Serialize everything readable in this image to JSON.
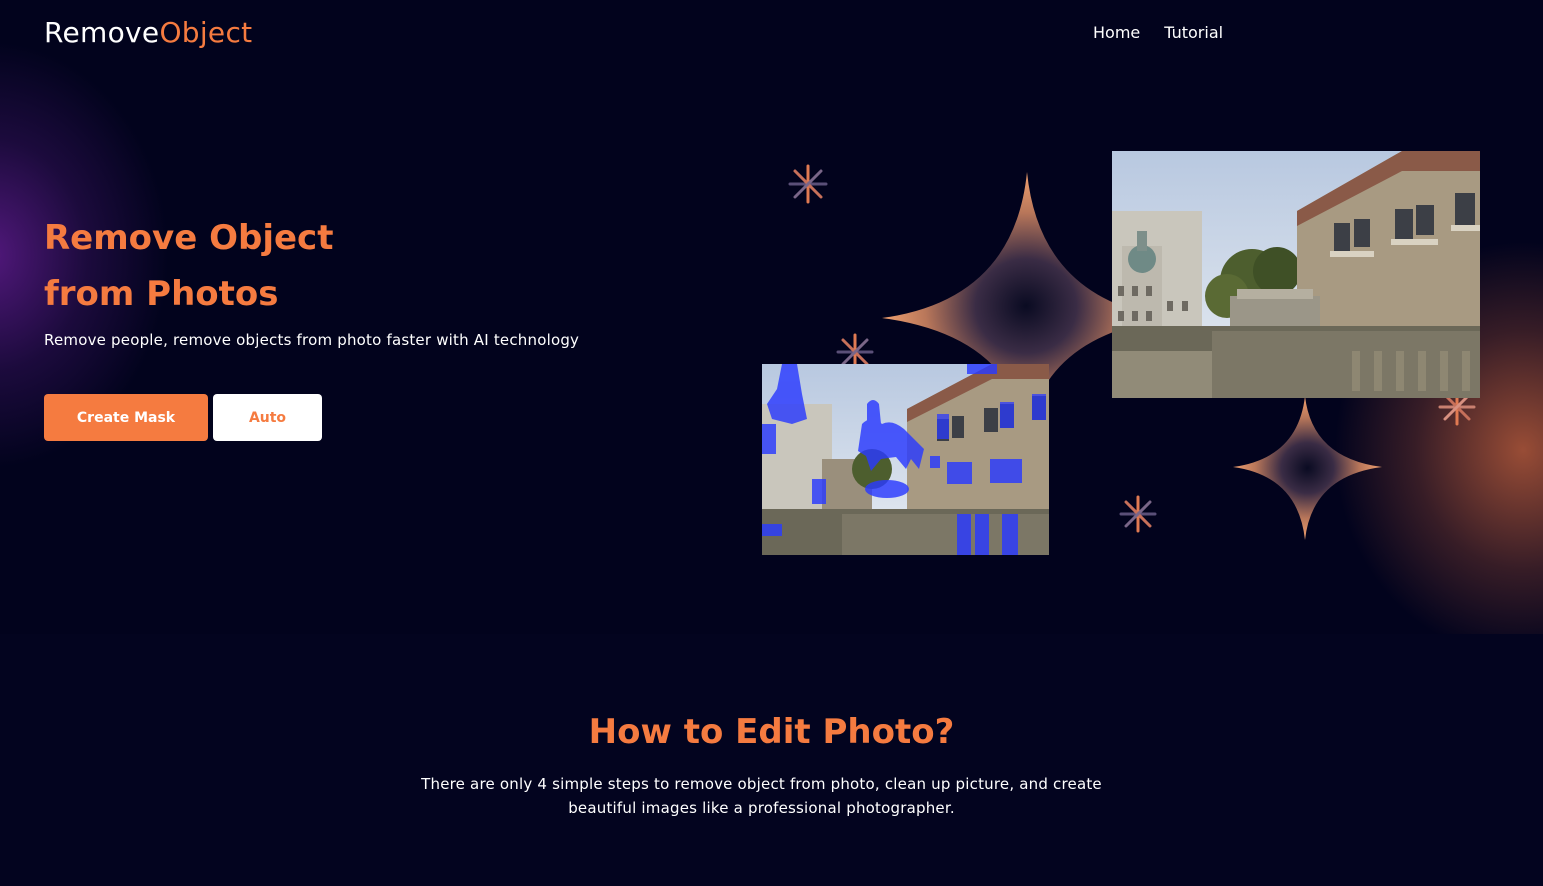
{
  "brand": {
    "name_part1": "Remove",
    "name_part2": "Object",
    "accent_color": "#f57b40",
    "background_color": "#02031d"
  },
  "nav": {
    "items": [
      {
        "label": "Home"
      },
      {
        "label": "Tutorial"
      }
    ]
  },
  "hero": {
    "title_line1": "Remove Object",
    "title_line2": "from Photos",
    "subtitle": "Remove people, remove objects from photo faster with AI technology",
    "buttons": {
      "create_mask": "Create Mask",
      "auto": "Auto"
    }
  },
  "how": {
    "title": "How to Edit Photo?",
    "description_line1": "There are only 4 simple steps to remove object from photo, clean up picture, and create",
    "description_line2": "beautiful images like a professional photographer."
  }
}
